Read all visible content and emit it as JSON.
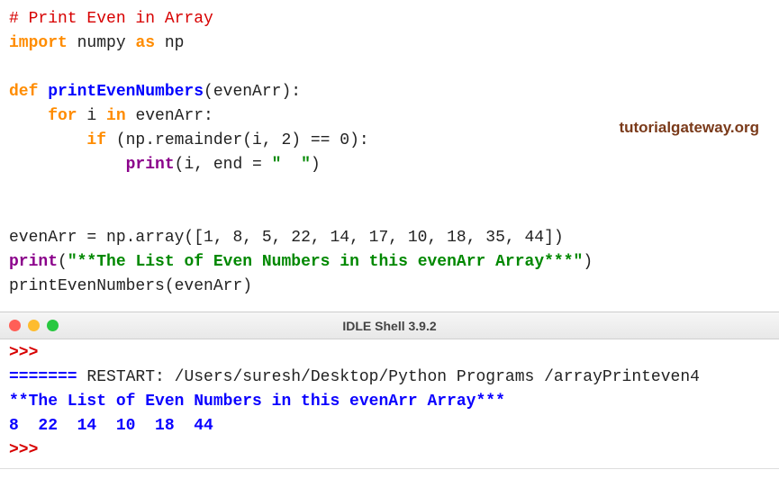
{
  "watermark": "tutorialgateway.org",
  "code": {
    "l1_comment": "# Print Even in Array",
    "l2_import": "import",
    "l2_numpy": " numpy ",
    "l2_as": "as",
    "l2_np": " np",
    "l3_def": "def",
    "l3_fname": " printEvenNumbers",
    "l3_paren": "(evenArr):",
    "l4_for": "    for",
    "l4_i": " i ",
    "l4_in": "in",
    "l4_arr": " evenArr:",
    "l5_if": "        if",
    "l5_cond_a": " (np.remainder(i, ",
    "l5_two": "2",
    "l5_cond_b": ") == ",
    "l5_zero": "0",
    "l5_cond_c": "):",
    "l6_indent": "            ",
    "l6_print": "print",
    "l6_args_a": "(i, end = ",
    "l6_str": "\"  \"",
    "l6_args_b": ")",
    "l7_assign": "evenArr = np.array([",
    "l7_nums": "1, 8, 5, 22, 14, 17, 10, 18, 35, 44",
    "l7_close": "])",
    "l8_print": "print",
    "l8_open": "(",
    "l8_str": "\"**The List of Even Numbers in this evenArr Array***\"",
    "l8_close": ")",
    "l9_call": "printEvenNumbers(evenArr)"
  },
  "shell": {
    "title": "IDLE Shell 3.9.2",
    "prompt_top": ">>>",
    "sep": "======= ",
    "restart": "RESTART: /Users/suresh/Desktop/Python Programs /arrayPrinteven4",
    "out1": "**The List of Even Numbers in this evenArr Array***",
    "out2": "8  22  14  10  18  44",
    "prompt_bottom": ">>> "
  }
}
